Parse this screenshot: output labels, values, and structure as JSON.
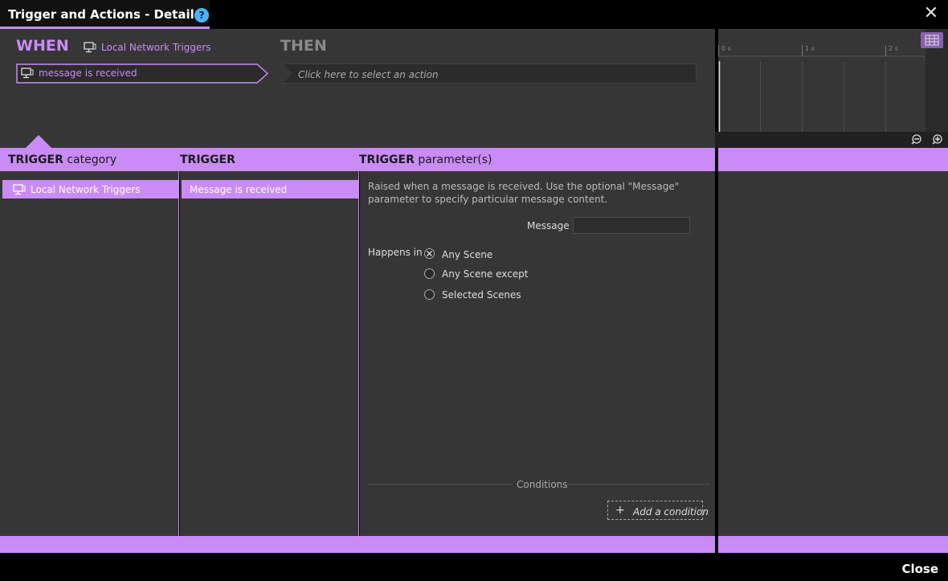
{
  "window": {
    "title": "Trigger and Actions - Details",
    "help_icon": "help-circle-icon",
    "help_glyph": "?",
    "close_glyph": "✕"
  },
  "when": {
    "label": "WHEN",
    "category_label": "Local Network Triggers",
    "category_icon": "network-monitor-icon",
    "selected_trigger": "message is received"
  },
  "then": {
    "label": "THEN",
    "action_placeholder": "Click here to select an action"
  },
  "timeline": {
    "ticks": [
      "0 s",
      "1 s",
      "2 s"
    ],
    "grid_icon": "timeline-grid-icon",
    "zoom_out_icon": "zoom-out-icon",
    "zoom_in_icon": "zoom-in-icon"
  },
  "headers": {
    "category": {
      "bold": "TRIGGER",
      "rest": "category"
    },
    "trigger": {
      "bold": "TRIGGER",
      "rest": ""
    },
    "parameters": {
      "bold": "TRIGGER",
      "rest": "parameter(s)"
    }
  },
  "categories": [
    {
      "label": "Local Network Triggers",
      "selected": true
    }
  ],
  "triggers": [
    {
      "label": "Message is received",
      "selected": true
    }
  ],
  "parameters": {
    "description": "Raised when a message is received. Use the optional \"Message\" parameter to specify particular message content.",
    "message_label": "Message",
    "message_value": "",
    "happens_in_label": "Happens in",
    "scene_options": [
      {
        "label": "Any Scene",
        "selected": true
      },
      {
        "label": "Any Scene except",
        "selected": false
      },
      {
        "label": "Selected Scenes",
        "selected": false
      }
    ],
    "conditions_label": "Conditions",
    "add_condition_label": "Add a condition"
  },
  "footer": {
    "close_label": "Close"
  },
  "colors": {
    "accent": "#c98cf6",
    "panel": "#363636",
    "background": "#000000"
  }
}
